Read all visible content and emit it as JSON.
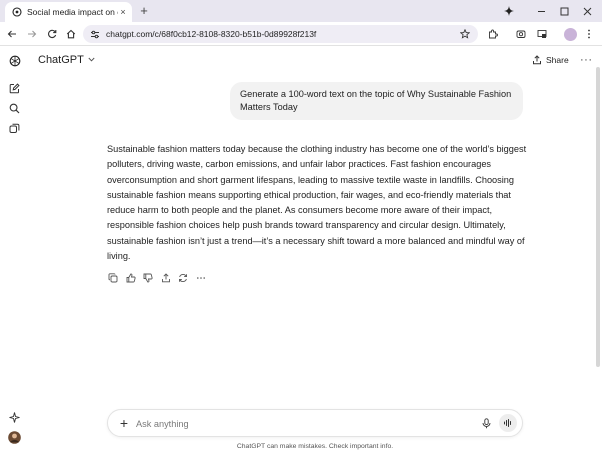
{
  "browser": {
    "tab_title": "Social media impact on colle",
    "url": "chatgpt.com/c/68f0cb12-8108-8320-b51b-0d89928f213f",
    "new_tab_glyph": "+",
    "close_glyph": "×",
    "profile_initials": "··"
  },
  "app": {
    "model_name": "ChatGPT",
    "share_label": "Share",
    "more_glyph": "···"
  },
  "conversation": {
    "user_message": "Generate a 100-word text on the topic of Why Sustainable Fashion Matters Today",
    "assistant_message": "Sustainable fashion matters today because the clothing industry has become one of the world’s biggest polluters, driving waste, carbon emissions, and unfair labor practices. Fast fashion encourages overconsumption and short garment lifespans, leading to massive textile waste in landfills. Choosing sustainable fashion means supporting ethical production, fair wages, and eco-friendly materials that reduce harm to both people and the planet. As consumers become more aware of their impact, responsible fashion choices help push brands toward transparency and circular design. Ultimately, sustainable fashion isn’t just a trend—it’s a necessary shift toward a more balanced and mindful way of living."
  },
  "composer": {
    "placeholder": "Ask anything",
    "plus_glyph": "+"
  },
  "footer": {
    "disclaimer": "ChatGPT can make mistakes. Check important info."
  },
  "icons": {
    "sidebar": [
      "openai-logo-icon",
      "new-chat-icon",
      "search-icon",
      "library-icon",
      "sparkle-icon",
      "user-avatar"
    ],
    "actions": [
      "copy-icon",
      "thumbs-up-icon",
      "thumbs-down-icon",
      "share-icon",
      "regenerate-icon",
      "more-icon"
    ]
  },
  "colors": {
    "tabstrip": "#e8e6f0",
    "omnibox": "#efedf5",
    "user_bubble": "#f2f2f2",
    "text": "#1f1f1f"
  }
}
